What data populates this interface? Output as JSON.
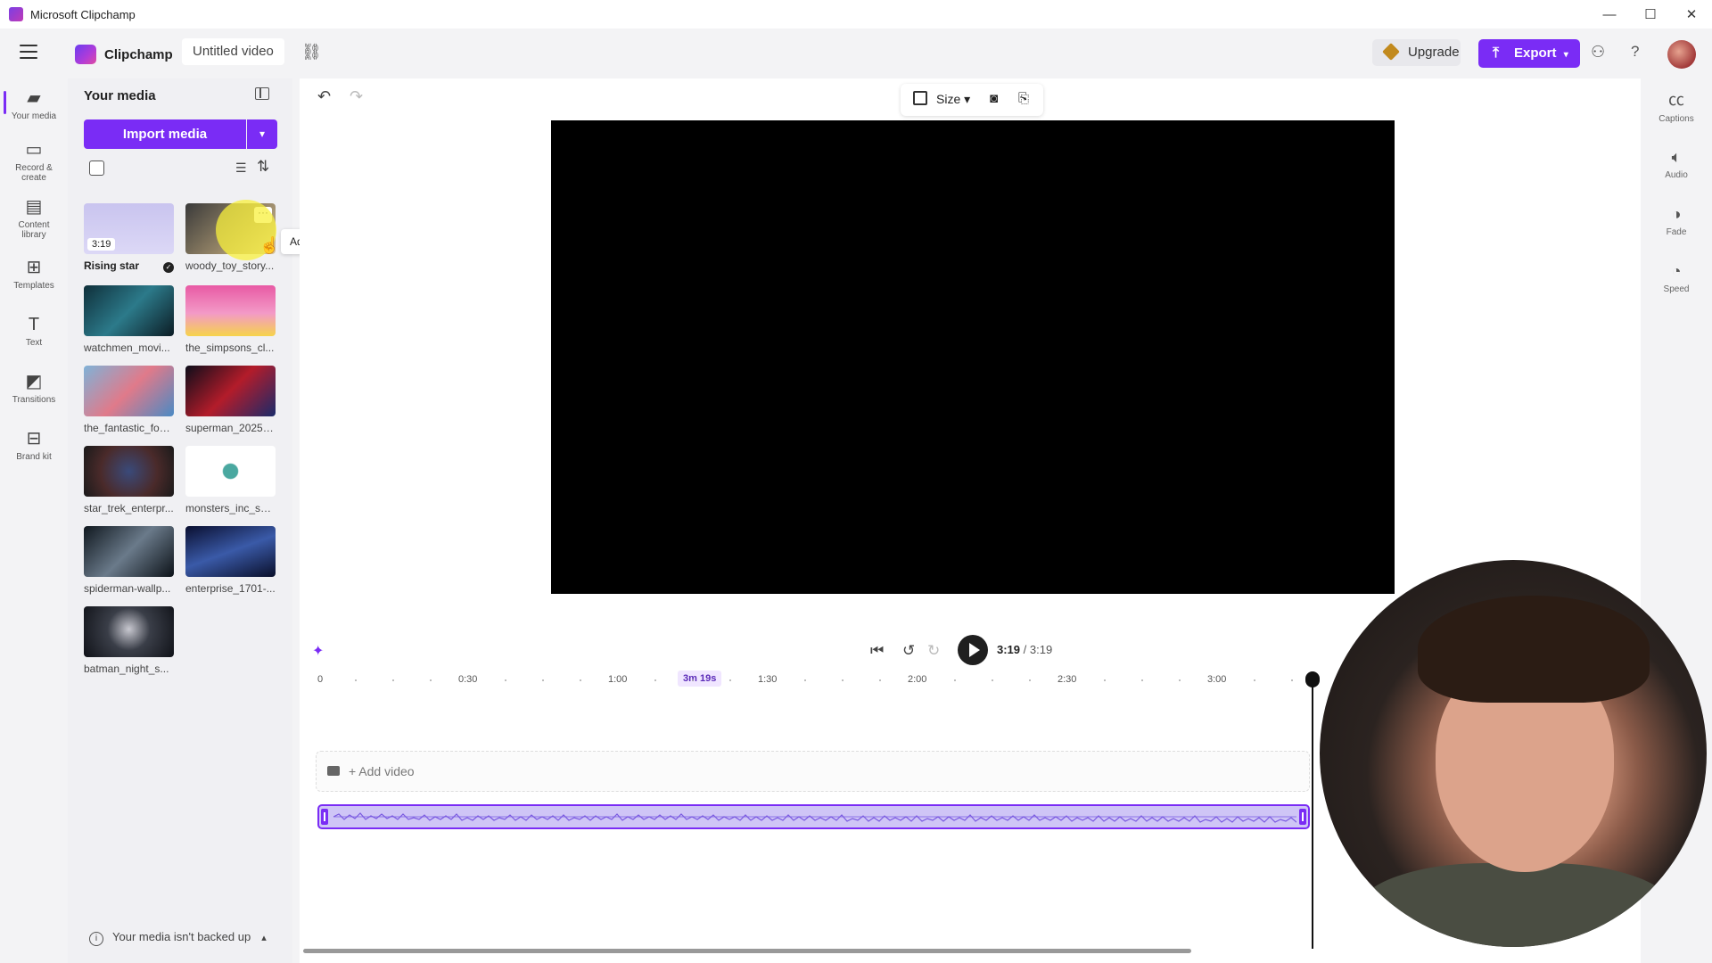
{
  "window": {
    "title": "Microsoft Clipchamp",
    "controls": [
      "—",
      "☐",
      "✕"
    ]
  },
  "header": {
    "brand": "Clipchamp",
    "project_title": "Untitled video",
    "upgrade_label": "Upgrade",
    "export_label": "Export",
    "accent_color": "#7a2cf5"
  },
  "left_rail": {
    "items": [
      {
        "label": "Your media",
        "icon": "folder-icon",
        "active": true
      },
      {
        "label": "Record & create",
        "icon": "camera-icon"
      },
      {
        "label": "Content library",
        "icon": "library-icon"
      },
      {
        "label": "Templates",
        "icon": "templates-icon"
      },
      {
        "label": "Text",
        "icon": "text-icon"
      },
      {
        "label": "Transitions",
        "icon": "transitions-icon"
      },
      {
        "label": "Brand kit",
        "icon": "brand-kit-icon"
      }
    ]
  },
  "media_panel": {
    "title": "Your media",
    "import_label": "Import media",
    "tiles": [
      {
        "name": "Rising star",
        "duration": "3:19",
        "added": true
      },
      {
        "name": "woody_toy_story..."
      },
      {
        "name": "watchmen_movi..."
      },
      {
        "name": "the_simpsons_cl..."
      },
      {
        "name": "the_fantastic_fou..."
      },
      {
        "name": "superman_2025_..."
      },
      {
        "name": "star_trek_enterpr..."
      },
      {
        "name": "monsters_inc_sul..."
      },
      {
        "name": "spiderman-wallp..."
      },
      {
        "name": "enterprise_1701-..."
      },
      {
        "name": "batman_night_s..."
      }
    ],
    "more_label": "···",
    "tooltip": "Add to timeline",
    "backup_text": "Your media isn't backed up"
  },
  "preview": {
    "size_label": "Size"
  },
  "right_rail": {
    "items": [
      {
        "label": "Captions",
        "icon": "captions-icon"
      },
      {
        "label": "Audio",
        "icon": "speaker-icon"
      },
      {
        "label": "Fade",
        "icon": "fade-icon"
      },
      {
        "label": "Speed",
        "icon": "speed-icon"
      }
    ]
  },
  "playback": {
    "current": "3:19",
    "total": "/ 3:19",
    "skip_back_label": "5",
    "skip_fwd_label": "5"
  },
  "timeline": {
    "ticks": [
      "0",
      "0:30",
      "1:00",
      "1:30",
      "2:00",
      "2:30",
      "3:00"
    ],
    "hover_time": "3m 19s",
    "add_video_label": "+ Add video"
  }
}
